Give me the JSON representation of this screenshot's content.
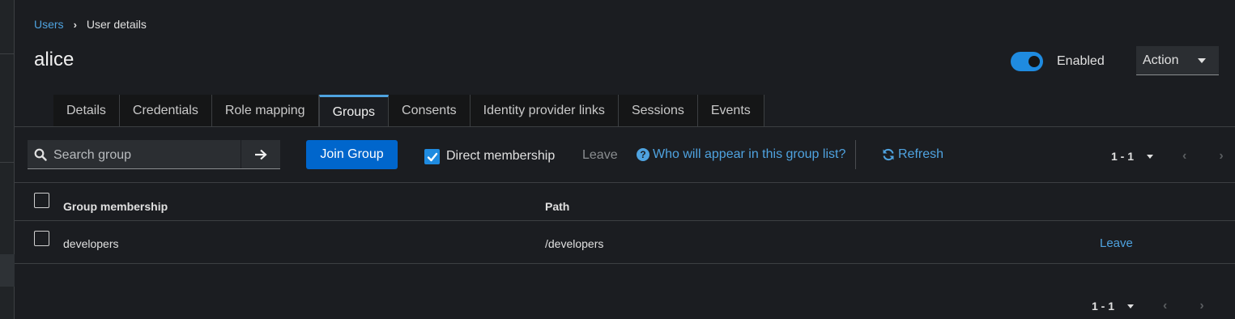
{
  "breadcrumb": {
    "parent": "Users",
    "current": "User details"
  },
  "page": {
    "title": "alice"
  },
  "status": {
    "enabled_label": "Enabled",
    "enabled": true
  },
  "action": {
    "label": "Action"
  },
  "tabs": [
    {
      "label": "Details"
    },
    {
      "label": "Credentials"
    },
    {
      "label": "Role mapping"
    },
    {
      "label": "Groups",
      "active": true
    },
    {
      "label": "Consents"
    },
    {
      "label": "Identity provider links"
    },
    {
      "label": "Sessions"
    },
    {
      "label": "Events"
    }
  ],
  "toolbar": {
    "search_placeholder": "Search group",
    "join_label": "Join Group",
    "direct_membership_label": "Direct membership",
    "direct_membership_checked": true,
    "leave_label": "Leave",
    "help_label": "Who will appear in this group list?",
    "refresh_label": "Refresh",
    "pagination": "1 - 1"
  },
  "table": {
    "headers": {
      "group": "Group membership",
      "path": "Path"
    },
    "rows": [
      {
        "group": "developers",
        "path": "/developers",
        "action": "Leave"
      }
    ]
  },
  "footer": {
    "pagination": "1 - 1"
  },
  "icons": {
    "breadcrumb_separator": "chevron-right-icon",
    "search": "search-icon",
    "go": "arrow-right-icon",
    "help": "question-circle-icon",
    "refresh": "sync-icon"
  },
  "colors": {
    "accent": "#4fa3e0",
    "primary_button": "#0066cc",
    "toggle_on": "#1f8be0",
    "background": "#1b1d21"
  }
}
